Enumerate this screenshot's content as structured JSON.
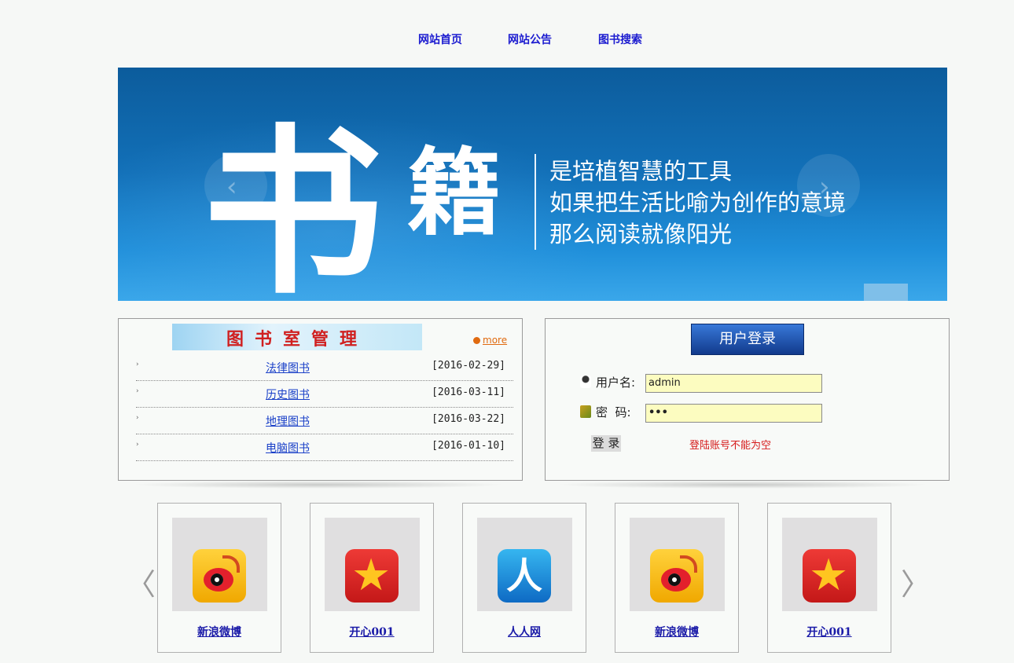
{
  "nav": {
    "items": [
      "网站首页",
      "网站公告",
      "图书搜索"
    ]
  },
  "banner": {
    "big_char_1": "书",
    "big_char_2": "籍",
    "slogan_lines": [
      "是培植智慧的工具",
      "如果把生活比喻为创作的意境",
      "那么阅读就像阳光"
    ],
    "prev_icon": "‹",
    "next_icon": "›"
  },
  "news": {
    "header_title": "图书室管理",
    "more_label": "more",
    "bullet": "›",
    "items": [
      {
        "title": "法律图书",
        "date": "[2016-02-29]"
      },
      {
        "title": "历史图书",
        "date": "[2016-03-11]"
      },
      {
        "title": "地理图书",
        "date": "[2016-03-22]"
      },
      {
        "title": "电脑图书",
        "date": "[2016-01-10]"
      }
    ]
  },
  "login": {
    "title": "用户登录",
    "username_label": "用户名:",
    "password_label": "密  码:",
    "username_value": "admin",
    "password_value": "•••",
    "submit_label": "登 录",
    "error_message": "登陆账号不能为空"
  },
  "links": {
    "prev_icon": "〈",
    "next_icon": "〉",
    "items": [
      {
        "name": "新浪微博",
        "icon": "weibo-icon"
      },
      {
        "name": "开心001",
        "icon": "kaixin-icon"
      },
      {
        "name": "人人网",
        "icon": "renren-icon"
      },
      {
        "name": "新浪微博",
        "icon": "weibo-icon"
      },
      {
        "name": "开心001",
        "icon": "kaixin-icon"
      }
    ]
  },
  "colors": {
    "nav_link": "#1b1bd0",
    "banner_blue": "#1270b8",
    "error_red": "#d51a1a",
    "input_bg": "#fcfcc0"
  }
}
